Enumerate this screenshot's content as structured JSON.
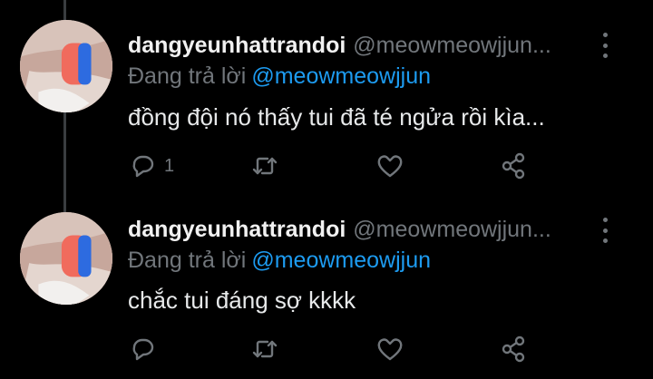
{
  "tweets": [
    {
      "display_name": "dangyeunhattrandoi",
      "handle": "@meowmeowjjun...",
      "replying_label": "Đang trả lời",
      "replying_to": "@meowmeowjjun",
      "text": "đồng đội nó thấy tui đã té ngửa rồi kìa...",
      "reply_count": "1"
    },
    {
      "display_name": "dangyeunhattrandoi",
      "handle": "@meowmeowjjun...",
      "replying_label": "Đang trả lời",
      "replying_to": "@meowmeowjjun",
      "text": "chắc tui đáng sợ kkkk",
      "reply_count": ""
    }
  ],
  "icons": {
    "reply": "reply-icon",
    "retweet": "retweet-icon",
    "like": "like-icon",
    "share": "share-icon",
    "more": "more-icon"
  },
  "colors": {
    "background": "#000000",
    "text": "#e7e9ea",
    "muted": "#71767b",
    "accent": "#1d9bf0"
  }
}
